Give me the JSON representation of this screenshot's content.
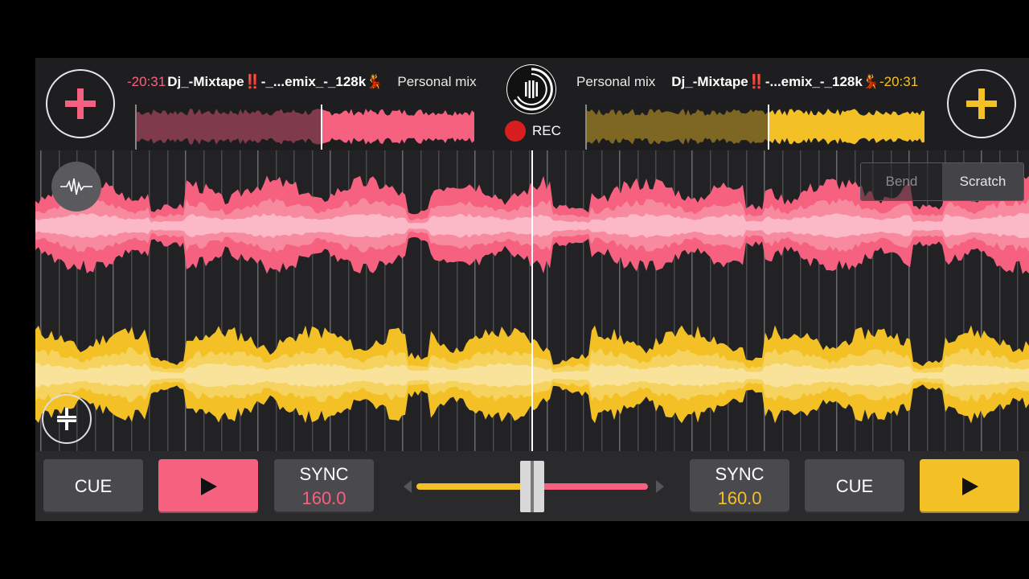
{
  "deck_a": {
    "color": "#f6617f",
    "time": "-20:31",
    "title": "Dj_-Mixtape‼️-_...emix_-_128k💃",
    "playlist": "Personal mix",
    "cue_label": "CUE",
    "sync_label": "SYNC",
    "bpm": "160.0",
    "play_icon": "play-icon",
    "progress": 0.55
  },
  "deck_b": {
    "color": "#f3c126",
    "time": "-20:31",
    "title": "Dj_-Mixtape‼️-...emix_-_128k💃",
    "playlist": "Personal mix",
    "cue_label": "CUE",
    "sync_label": "SYNC",
    "bpm": "160.0",
    "play_icon": "play-icon",
    "progress": 0.54
  },
  "center": {
    "rec_label": "REC"
  },
  "modes": {
    "bend_label": "Bend",
    "scratch_label": "Scratch",
    "selected": "Scratch"
  },
  "crossfader": {
    "position": 0.5
  }
}
